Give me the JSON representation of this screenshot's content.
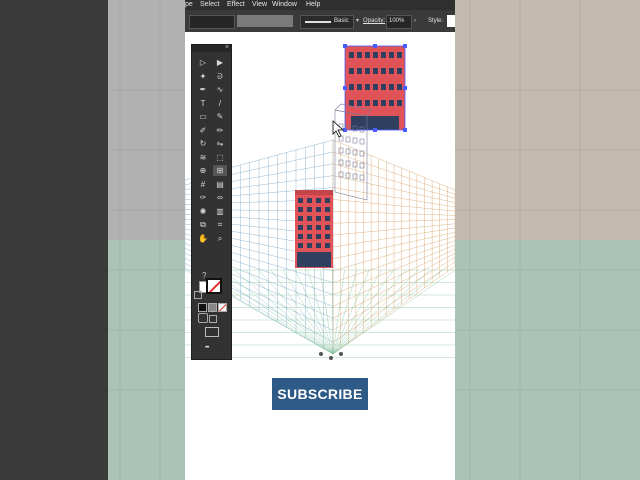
{
  "app": {
    "menu": [
      "pe",
      "Select",
      "Effect",
      "View",
      "Window",
      "Help"
    ]
  },
  "control_bar": {
    "stroke_style": "Basic",
    "opacity_label": "Opacity:",
    "opacity_value": "100%",
    "style_label": "Style:"
  },
  "toolbox": {
    "tools": [
      "selection-tool",
      "direct-selection-tool",
      "magic-wand-tool",
      "lasso-tool",
      "pen-tool",
      "curvature-tool",
      "type-tool",
      "line-segment-tool",
      "rectangle-tool",
      "paintbrush-tool",
      "shaper-tool",
      "pencil-tool",
      "rotate-tool",
      "reflect-tool",
      "width-tool",
      "free-transform-tool",
      "shape-builder-tool",
      "perspective-grid-tool",
      "mesh-tool",
      "gradient-tool",
      "eyedropper-tool",
      "blend-tool",
      "symbol-sprayer-tool",
      "column-graph-tool",
      "artboard-tool",
      "slice-tool",
      "hand-tool",
      "zoom-tool"
    ],
    "help_glyph": "?",
    "more_glyph": "•••"
  },
  "cta": {
    "subscribe_label": "SUBSCRIBE",
    "color": "#2d5a86"
  },
  "colors": {
    "building_red": "#e05358",
    "building_navy": "#2f3f5f",
    "grid_blue": "#7aa7c7",
    "grid_orange": "#d5a36a",
    "grid_green": "#7fbf9a",
    "toolbox_bg": "#323232"
  }
}
